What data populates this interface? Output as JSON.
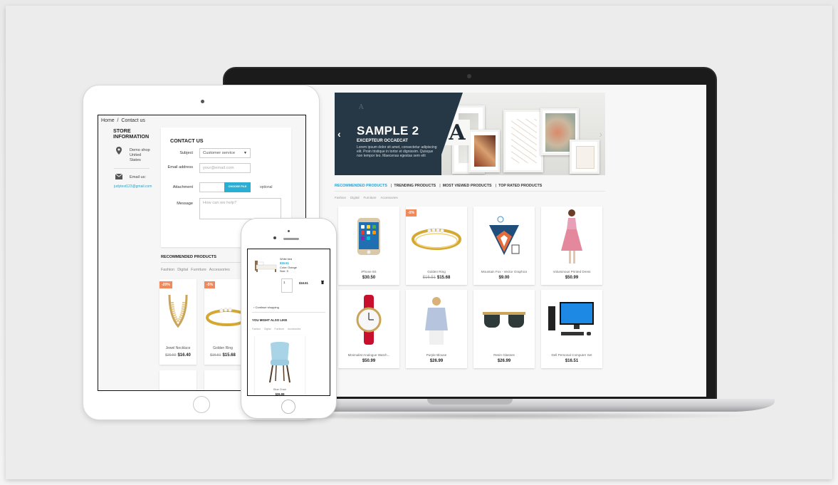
{
  "laptop": {
    "banner": {
      "title": "SAMPLE 2",
      "subtitle": "EXCEPTEUR OCCAECAT",
      "text": "Lorem ipsum dolor sit amet, consectetur adipiscing elit. Proin tristique in tortor et dignissim. Quisque non tempor leo. Maecenas egestas sem elit",
      "prev_icon": "‹",
      "next_icon": "›",
      "logo_letter": "A"
    },
    "tabs": [
      "RECOMMENDED PRODUCTS",
      "TRENDING PRODUCTS",
      "MOST VIEWED PRODUCTS",
      "TOP RATED PRODUCTS"
    ],
    "sub_tabs": [
      "Fashion",
      "Digital",
      "Furniture",
      "Accessories"
    ],
    "products": [
      {
        "name": "iPhone 6S",
        "price": "$30.50",
        "old": "",
        "badge": ""
      },
      {
        "name": "Golden Ring",
        "price": "$15.68",
        "old": "$16.51",
        "badge": "-5%"
      },
      {
        "name": "Mountain Fox - Vector Graphics",
        "price": "$9.00",
        "old": "",
        "badge": ""
      },
      {
        "name": "Voluminous Printed Dress",
        "price": "$50.99",
        "old": "",
        "badge": ""
      },
      {
        "name": "Minimalist Analogue Watch...",
        "price": "$50.99",
        "old": "",
        "badge": ""
      },
      {
        "name": "Purple Blouse",
        "price": "$26.99",
        "old": "",
        "badge": ""
      },
      {
        "name": "Resin Glasses",
        "price": "$26.99",
        "old": "",
        "badge": ""
      },
      {
        "name": "Dell Personal Computer Set",
        "price": "$16.51",
        "old": "",
        "badge": ""
      }
    ]
  },
  "tablet": {
    "breadcrumb": "Home  /  Contact us",
    "store_title": "STORE INFORMATION",
    "address": "Demo shop\nUnited\nStates",
    "email_label": "Email us:",
    "email": "judytest123@gmail.com",
    "form": {
      "title": "CONTACT US",
      "subject_label": "Subject",
      "subject_value": "Customer service",
      "email_label": "Email address",
      "email_placeholder": "your@email.com",
      "attachment_label": "Attachment",
      "choose_file": "CHOOSE FILE",
      "optional": "optional",
      "message_label": "Message",
      "message_placeholder": "How can we help?"
    },
    "recommended_title": "RECOMMENDED PRODUCTS",
    "cats": [
      "Fashion",
      "Digital",
      "Furniture",
      "Accessories"
    ],
    "products": [
      {
        "name": "Jewel Necklace",
        "price": "$16.40",
        "old": "$20.50",
        "badge": "-20%"
      },
      {
        "name": "Golden Ring",
        "price": "$15.68",
        "old": "$16.51",
        "badge": "-5%"
      }
    ]
  },
  "phone": {
    "item_name": "White bed",
    "item_price": "$16.51",
    "item_color": "Color: Orange",
    "item_size": "Size: S",
    "qty": "1",
    "line_total": "$16.51",
    "continue": "Continue shopping",
    "might_like": "YOU MIGHT ALSO LIKE",
    "cats": [
      "Fashion",
      "Digital",
      "Furniture",
      "Accessories"
    ],
    "product": {
      "name": "Blue Chair",
      "price": "$26.99"
    }
  },
  "colors": {
    "accent": "#2e9ec7",
    "badge": "#f08a5d",
    "banner_dark": "#263845"
  }
}
